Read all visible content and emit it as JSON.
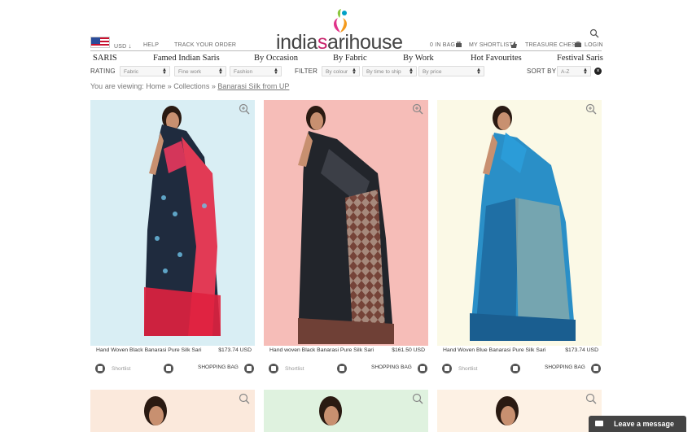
{
  "header": {
    "currency": "USD",
    "currency_arrow": "↓",
    "help": "HELP",
    "track_order": "TRACK YOUR ORDER",
    "logo_pre": "india",
    "logo_accent": "s",
    "logo_mid": "ari",
    "logo_post": "house",
    "bag": "0 IN BAG",
    "shortlist": "MY SHORTLIST",
    "treasure_chest": "TREASURE CHEST",
    "login": "LOGIN"
  },
  "nav": [
    "SARIS",
    "Famed Indian Saris",
    "By Occasion",
    "By Fabric",
    "By Work",
    "Hot Favourites",
    "Festival Saris"
  ],
  "filters": {
    "rating_label": "RATING",
    "rating_selects": [
      "Fabric",
      "Fine work",
      "Fashion"
    ],
    "filter_label": "FILTER",
    "filter_selects": [
      "By colour",
      "By time to ship",
      "By price"
    ],
    "sort_label": "SORT BY",
    "sort_value": "A-Z",
    "clear": "×"
  },
  "breadcrumb": {
    "prefix": "You are viewing:",
    "home": "Home",
    "sep1": "»",
    "collections": "Collections",
    "sep2": "»",
    "current": "Banarasi Silk from UP"
  },
  "products": [
    {
      "name": "Hand Woven Black Banarasi Pure Silk Sari",
      "price": "$173.74 USD",
      "shortlist": "Shortlist",
      "bag": "SHOPPING BAG",
      "bg": "#d9eef4"
    },
    {
      "name": "Hand woven Black Banarasi Pure Silk Sari",
      "price": "$161.50 USD",
      "shortlist": "Shortlist",
      "bag": "SHOPPING BAG",
      "bg": "#f6bdb8"
    },
    {
      "name": "Hand Woven Blue Banarasi Pure Silk Sari",
      "price": "$173.74 USD",
      "shortlist": "Shortlist",
      "bag": "SHOPPING BAG",
      "bg": "#fbf9e6"
    }
  ],
  "row2_bgs": [
    "#fbe9dc",
    "#dff2df",
    "#fdf1e4"
  ],
  "chat": {
    "label": "Leave a message"
  }
}
